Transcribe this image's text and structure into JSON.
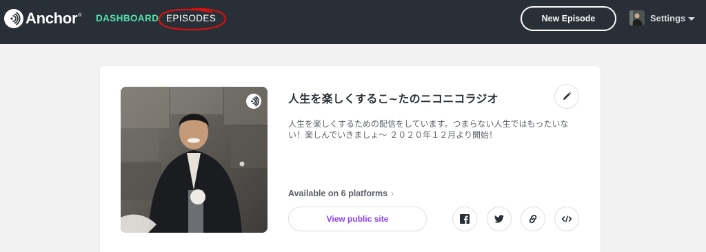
{
  "nav": {
    "brand": "Anchor",
    "brand_mark": "®",
    "dashboard": "DASHBOARD",
    "episodes": "EPISODES",
    "new_episode": "New Episode",
    "settings": "Settings"
  },
  "podcast": {
    "title": "人生を楽しくするこ~たのニコニコラジオ",
    "description": "人生を楽しくするための配信をしています。つまらない人生ではもったいない！楽しんでいきましょ～ ２０２０年１２月より開始！",
    "platforms_label": "Available on 6 platforms",
    "view_public_site": "View public site"
  },
  "icons": {
    "logo": "anchor-logo-icon",
    "badge": "anchor-badge-icon",
    "edit": "pencil-icon",
    "facebook": "facebook-icon",
    "twitter": "twitter-icon",
    "link": "link-icon",
    "embed": "embed-code-icon",
    "caret": "caret-down-icon",
    "chevron": "chevron-right-icon"
  },
  "colors": {
    "topbar": "#292f36",
    "active_nav": "#55e2b0",
    "accent_purple": "#8940fa",
    "annotation_red": "#e01010"
  }
}
